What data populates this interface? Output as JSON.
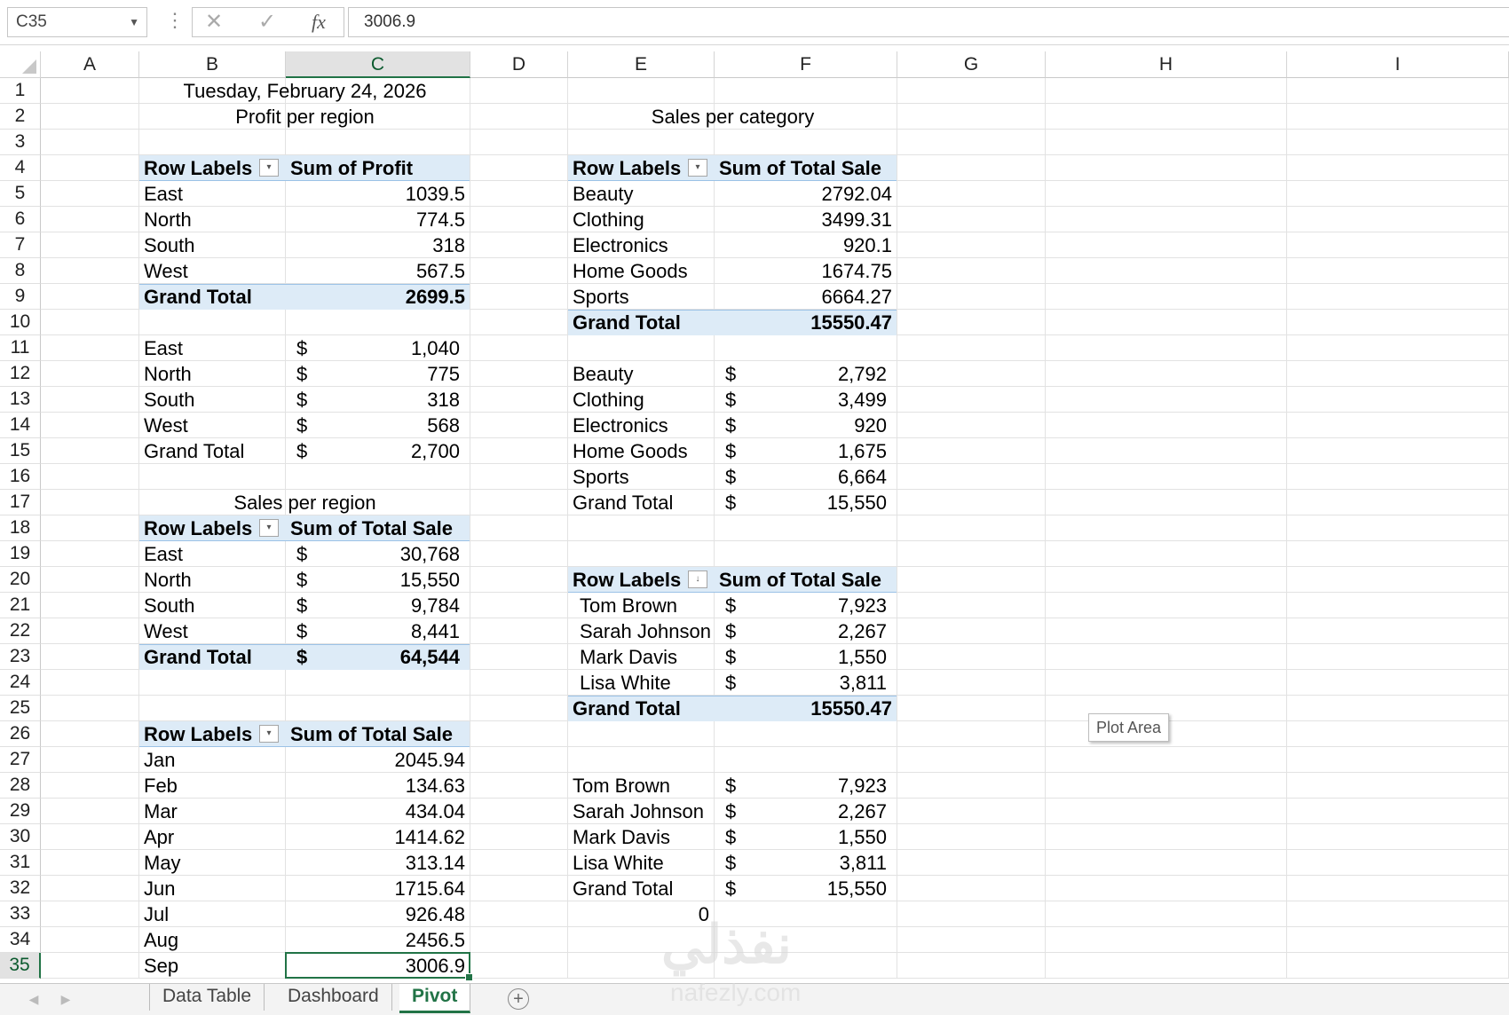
{
  "formula_bar": {
    "name_box": "C35",
    "value": "3006.9",
    "cancel_glyph": "✕",
    "enter_glyph": "✓",
    "fx_glyph": "fx"
  },
  "columns": [
    "A",
    "B",
    "C",
    "D",
    "E",
    "F",
    "G",
    "H",
    "I"
  ],
  "rows": [
    "1",
    "2",
    "3",
    "4",
    "5",
    "6",
    "7",
    "8",
    "9",
    "10",
    "11",
    "12",
    "13",
    "14",
    "15",
    "16",
    "17",
    "18",
    "19",
    "20",
    "21",
    "22",
    "23",
    "24",
    "25",
    "26",
    "27",
    "28",
    "29",
    "30",
    "31",
    "32",
    "33",
    "34",
    "35"
  ],
  "sheet": {
    "date": "Tuesday, February 24, 2026",
    "profit_title": "Profit per region",
    "category_title": "Sales per category",
    "sales_region_title": "Sales per region",
    "row_labels": "Row Labels",
    "sum_profit": "Sum of Profit",
    "sum_total_sale": "Sum of Total Sale",
    "grand_total": "Grand Total",
    "currency": "$",
    "profit_pivot": [
      {
        "label": "East",
        "value": "1039.5"
      },
      {
        "label": "North",
        "value": "774.5"
      },
      {
        "label": "South",
        "value": "318"
      },
      {
        "label": "West",
        "value": "567.5"
      }
    ],
    "profit_pivot_total": "2699.5",
    "profit_fmt": [
      {
        "label": "East",
        "value": "1,040"
      },
      {
        "label": "North",
        "value": "775"
      },
      {
        "label": "South",
        "value": "318"
      },
      {
        "label": "West",
        "value": "568"
      },
      {
        "label": "Grand Total",
        "value": "2,700"
      }
    ],
    "sales_region": [
      {
        "label": "East",
        "value": "30,768"
      },
      {
        "label": "North",
        "value": "15,550"
      },
      {
        "label": "South",
        "value": "9,784"
      },
      {
        "label": "West",
        "value": "8,441"
      }
    ],
    "sales_region_total": "64,544",
    "months": [
      {
        "label": "Jan",
        "value": "2045.94"
      },
      {
        "label": "Feb",
        "value": "134.63"
      },
      {
        "label": "Mar",
        "value": "434.04"
      },
      {
        "label": "Apr",
        "value": "1414.62"
      },
      {
        "label": "May",
        "value": "313.14"
      },
      {
        "label": "Jun",
        "value": "1715.64"
      },
      {
        "label": "Jul",
        "value": "926.48"
      },
      {
        "label": "Aug",
        "value": "2456.5"
      },
      {
        "label": "Sep",
        "value": "3006.9"
      }
    ],
    "category_pivot": [
      {
        "label": "Beauty",
        "value": "2792.04"
      },
      {
        "label": "Clothing",
        "value": "3499.31"
      },
      {
        "label": "Electronics",
        "value": "920.1"
      },
      {
        "label": "Home Goods",
        "value": "1674.75"
      },
      {
        "label": "Sports",
        "value": "6664.27"
      }
    ],
    "category_pivot_total": "15550.47",
    "category_fmt": [
      {
        "label": "Beauty",
        "value": "2,792"
      },
      {
        "label": "Clothing",
        "value": "3,499"
      },
      {
        "label": "Electronics",
        "value": "920"
      },
      {
        "label": "Home Goods",
        "value": "1,675"
      },
      {
        "label": "Sports",
        "value": "6,664"
      },
      {
        "label": "Grand Total",
        "value": "15,550"
      }
    ],
    "sales_person_pivot": [
      {
        "label": "Tom Brown",
        "value": "7,923"
      },
      {
        "label": "Sarah Johnson",
        "value": "2,267"
      },
      {
        "label": "Mark Davis",
        "value": "1,550"
      },
      {
        "label": "Lisa White",
        "value": "3,811"
      }
    ],
    "sales_person_total": "15550.47",
    "sales_person_fmt": [
      {
        "label": "Tom Brown",
        "value": "7,923"
      },
      {
        "label": "Sarah Johnson",
        "value": "2,267"
      },
      {
        "label": "Mark Davis",
        "value": "1,550"
      },
      {
        "label": "Lisa White",
        "value": "3,811"
      },
      {
        "label": "Grand Total",
        "value": "15,550"
      }
    ],
    "e33_value": "0"
  },
  "tooltip": "Plot Area",
  "tabs": [
    "Data Table",
    "Dashboard",
    "Pivot"
  ],
  "active_tab": "Pivot",
  "add_sheet": "+",
  "watermark": "نفذلي",
  "watermark_url": "nafezly.com"
}
